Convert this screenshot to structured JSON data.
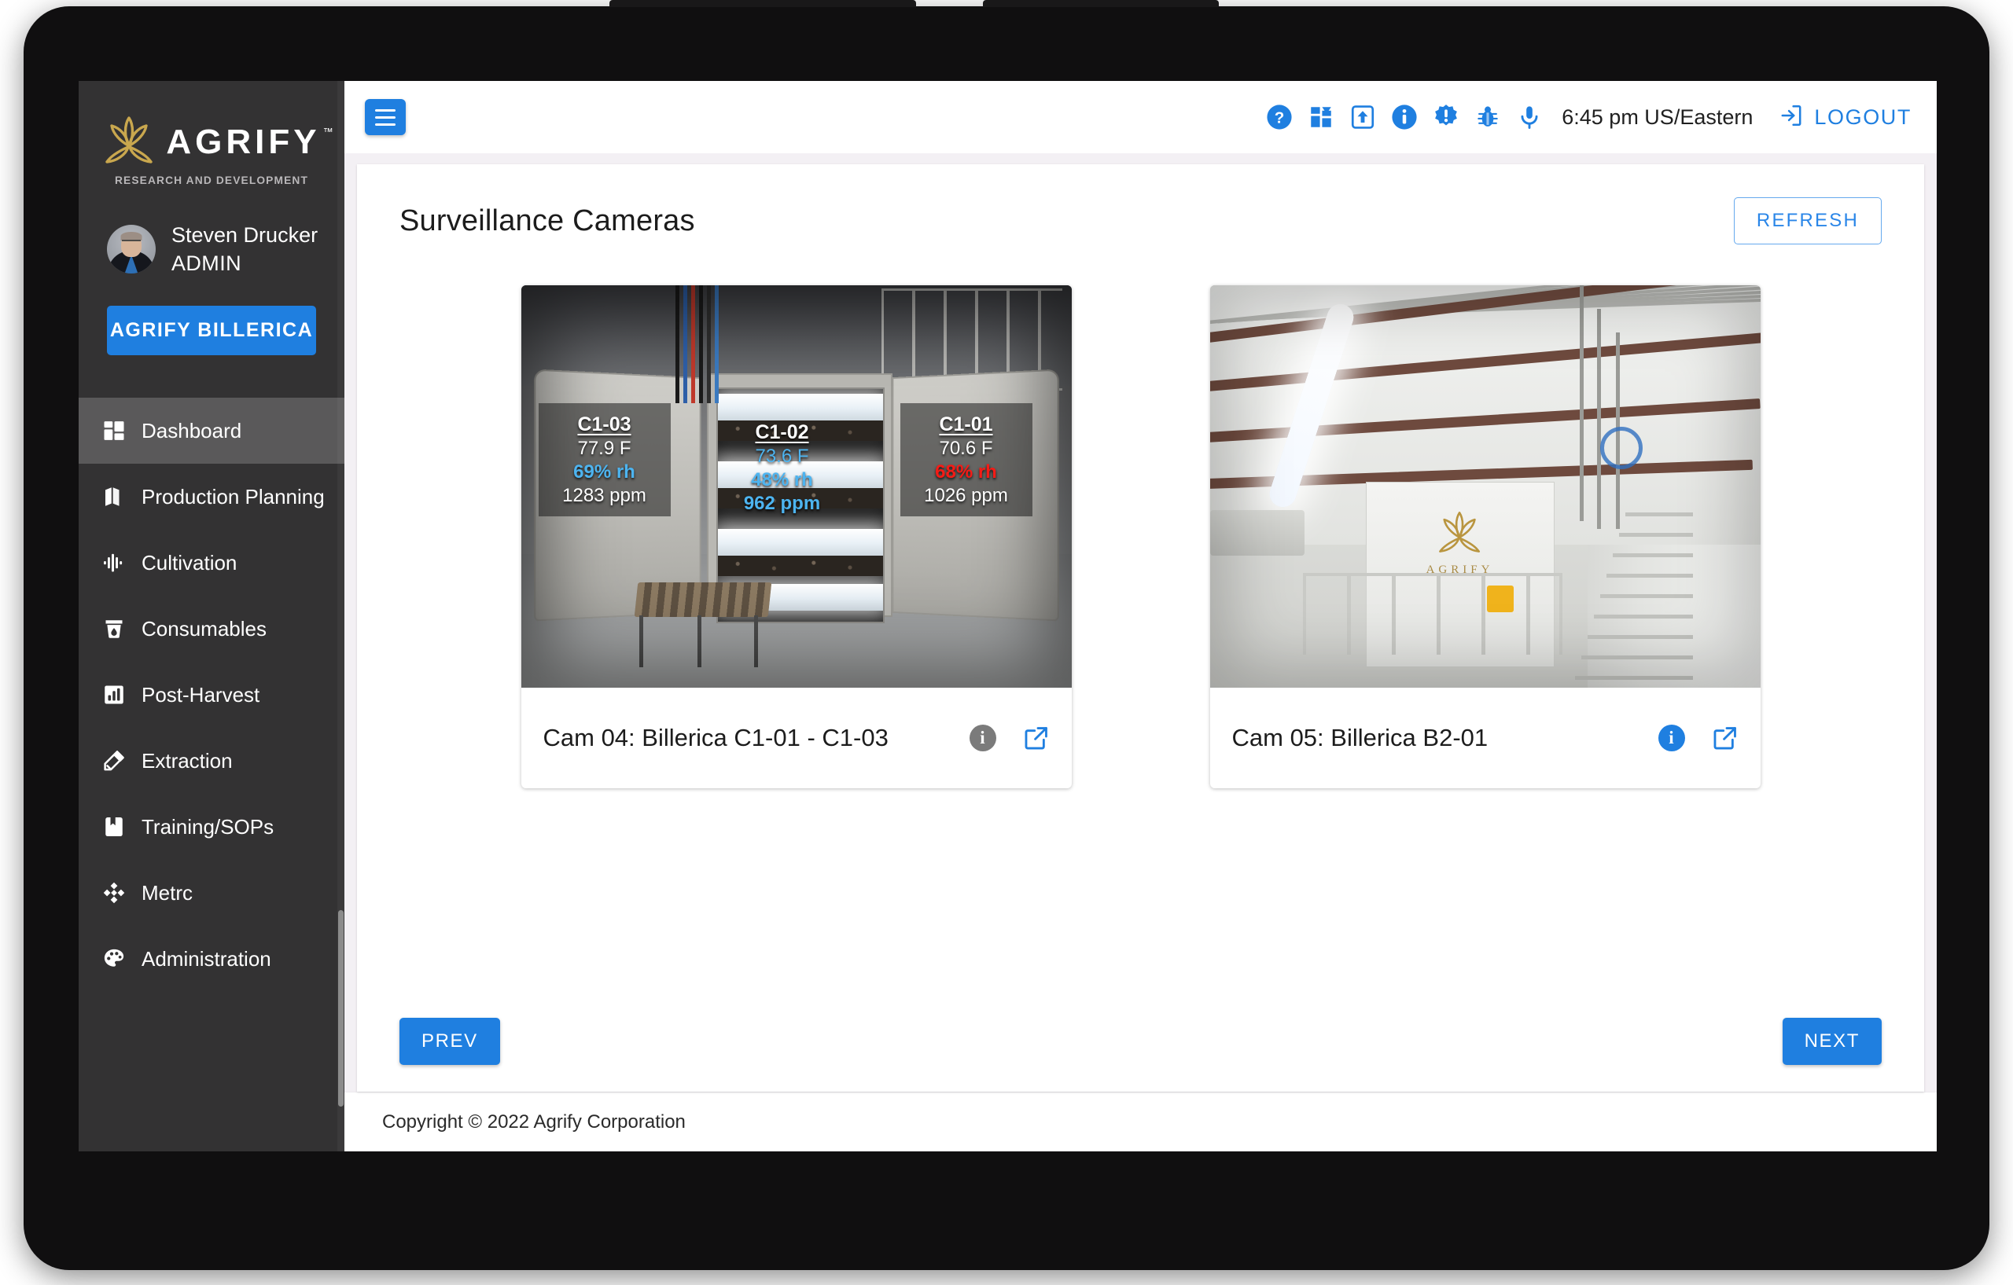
{
  "brand": {
    "name": "AGRIFY",
    "tm": "™",
    "tagline": "RESEARCH AND DEVELOPMENT"
  },
  "user": {
    "name": "Steven Drucker",
    "role": "ADMIN"
  },
  "site_button": {
    "label": "AGRIFY BILLERICA"
  },
  "sidebar": {
    "items": [
      {
        "label": "Dashboard",
        "icon": "dashboard-icon",
        "active": true
      },
      {
        "label": "Production Planning",
        "icon": "map-icon",
        "active": false
      },
      {
        "label": "Cultivation",
        "icon": "waveform-icon",
        "active": false
      },
      {
        "label": "Consumables",
        "icon": "cup-icon",
        "active": false
      },
      {
        "label": "Post-Harvest",
        "icon": "bar-chart-icon",
        "active": false
      },
      {
        "label": "Extraction",
        "icon": "dropper-icon",
        "active": false
      },
      {
        "label": "Training/SOPs",
        "icon": "book-icon",
        "active": false
      },
      {
        "label": "Metrc",
        "icon": "metrc-diamond-icon",
        "active": false
      },
      {
        "label": "Administration",
        "icon": "palette-icon",
        "active": false
      }
    ]
  },
  "topbar": {
    "menu_icon": "hamburger-icon",
    "icons": [
      "help-circle-icon",
      "apps-grid-icon",
      "upload-box-icon",
      "info-circle-icon",
      "alert-badge-icon",
      "bug-icon",
      "microphone-icon"
    ],
    "clock": "6:45 pm US/Eastern",
    "logout_icon": "logout-icon",
    "logout_label": "LOGOUT"
  },
  "page": {
    "title": "Surveillance Cameras",
    "refresh_label": "REFRESH"
  },
  "cameras": [
    {
      "name": "Cam 04: Billerica C1-01 - C1-03",
      "info_icon": "info-circle-icon",
      "info_state": "inactive",
      "open_icon": "external-link-icon",
      "overlays": [
        {
          "id": "C1-03",
          "temp": "77.9 F",
          "humidity": "69% rh",
          "co2": "1283 ppm",
          "temp_color": "#ffffff",
          "humidity_color": "#4db4f0",
          "co2_color": "#ffffff",
          "boxed": true
        },
        {
          "id": "C1-02",
          "temp": "73.6 F",
          "humidity": "48% rh",
          "co2": "962 ppm",
          "temp_color": "#4db4f0",
          "humidity_color": "#4db4f0",
          "co2_color": "#4db4f0",
          "boxed": false
        },
        {
          "id": "C1-01",
          "temp": "70.6 F",
          "humidity": "68% rh",
          "co2": "1026 ppm",
          "temp_color": "#ffffff",
          "humidity_color": "#f51b16",
          "co2_color": "#ffffff",
          "boxed": true
        }
      ]
    },
    {
      "name": "Cam 05: Billerica B2-01",
      "info_icon": "info-circle-icon",
      "info_state": "active",
      "open_icon": "external-link-icon",
      "pod_label": "AGRIFY",
      "overlays": []
    }
  ],
  "pager": {
    "prev_label": "PREV",
    "next_label": "NEXT"
  },
  "footer": {
    "copyright": "Copyright © 2022 Agrify Corporation"
  },
  "colors": {
    "accent": "#1f7fe0",
    "sidebar_bg": "#333233",
    "sidebar_active": "#5a595a",
    "gold": "#c9a74e",
    "alert_red": "#f51b16",
    "reading_blue": "#4db4f0"
  }
}
